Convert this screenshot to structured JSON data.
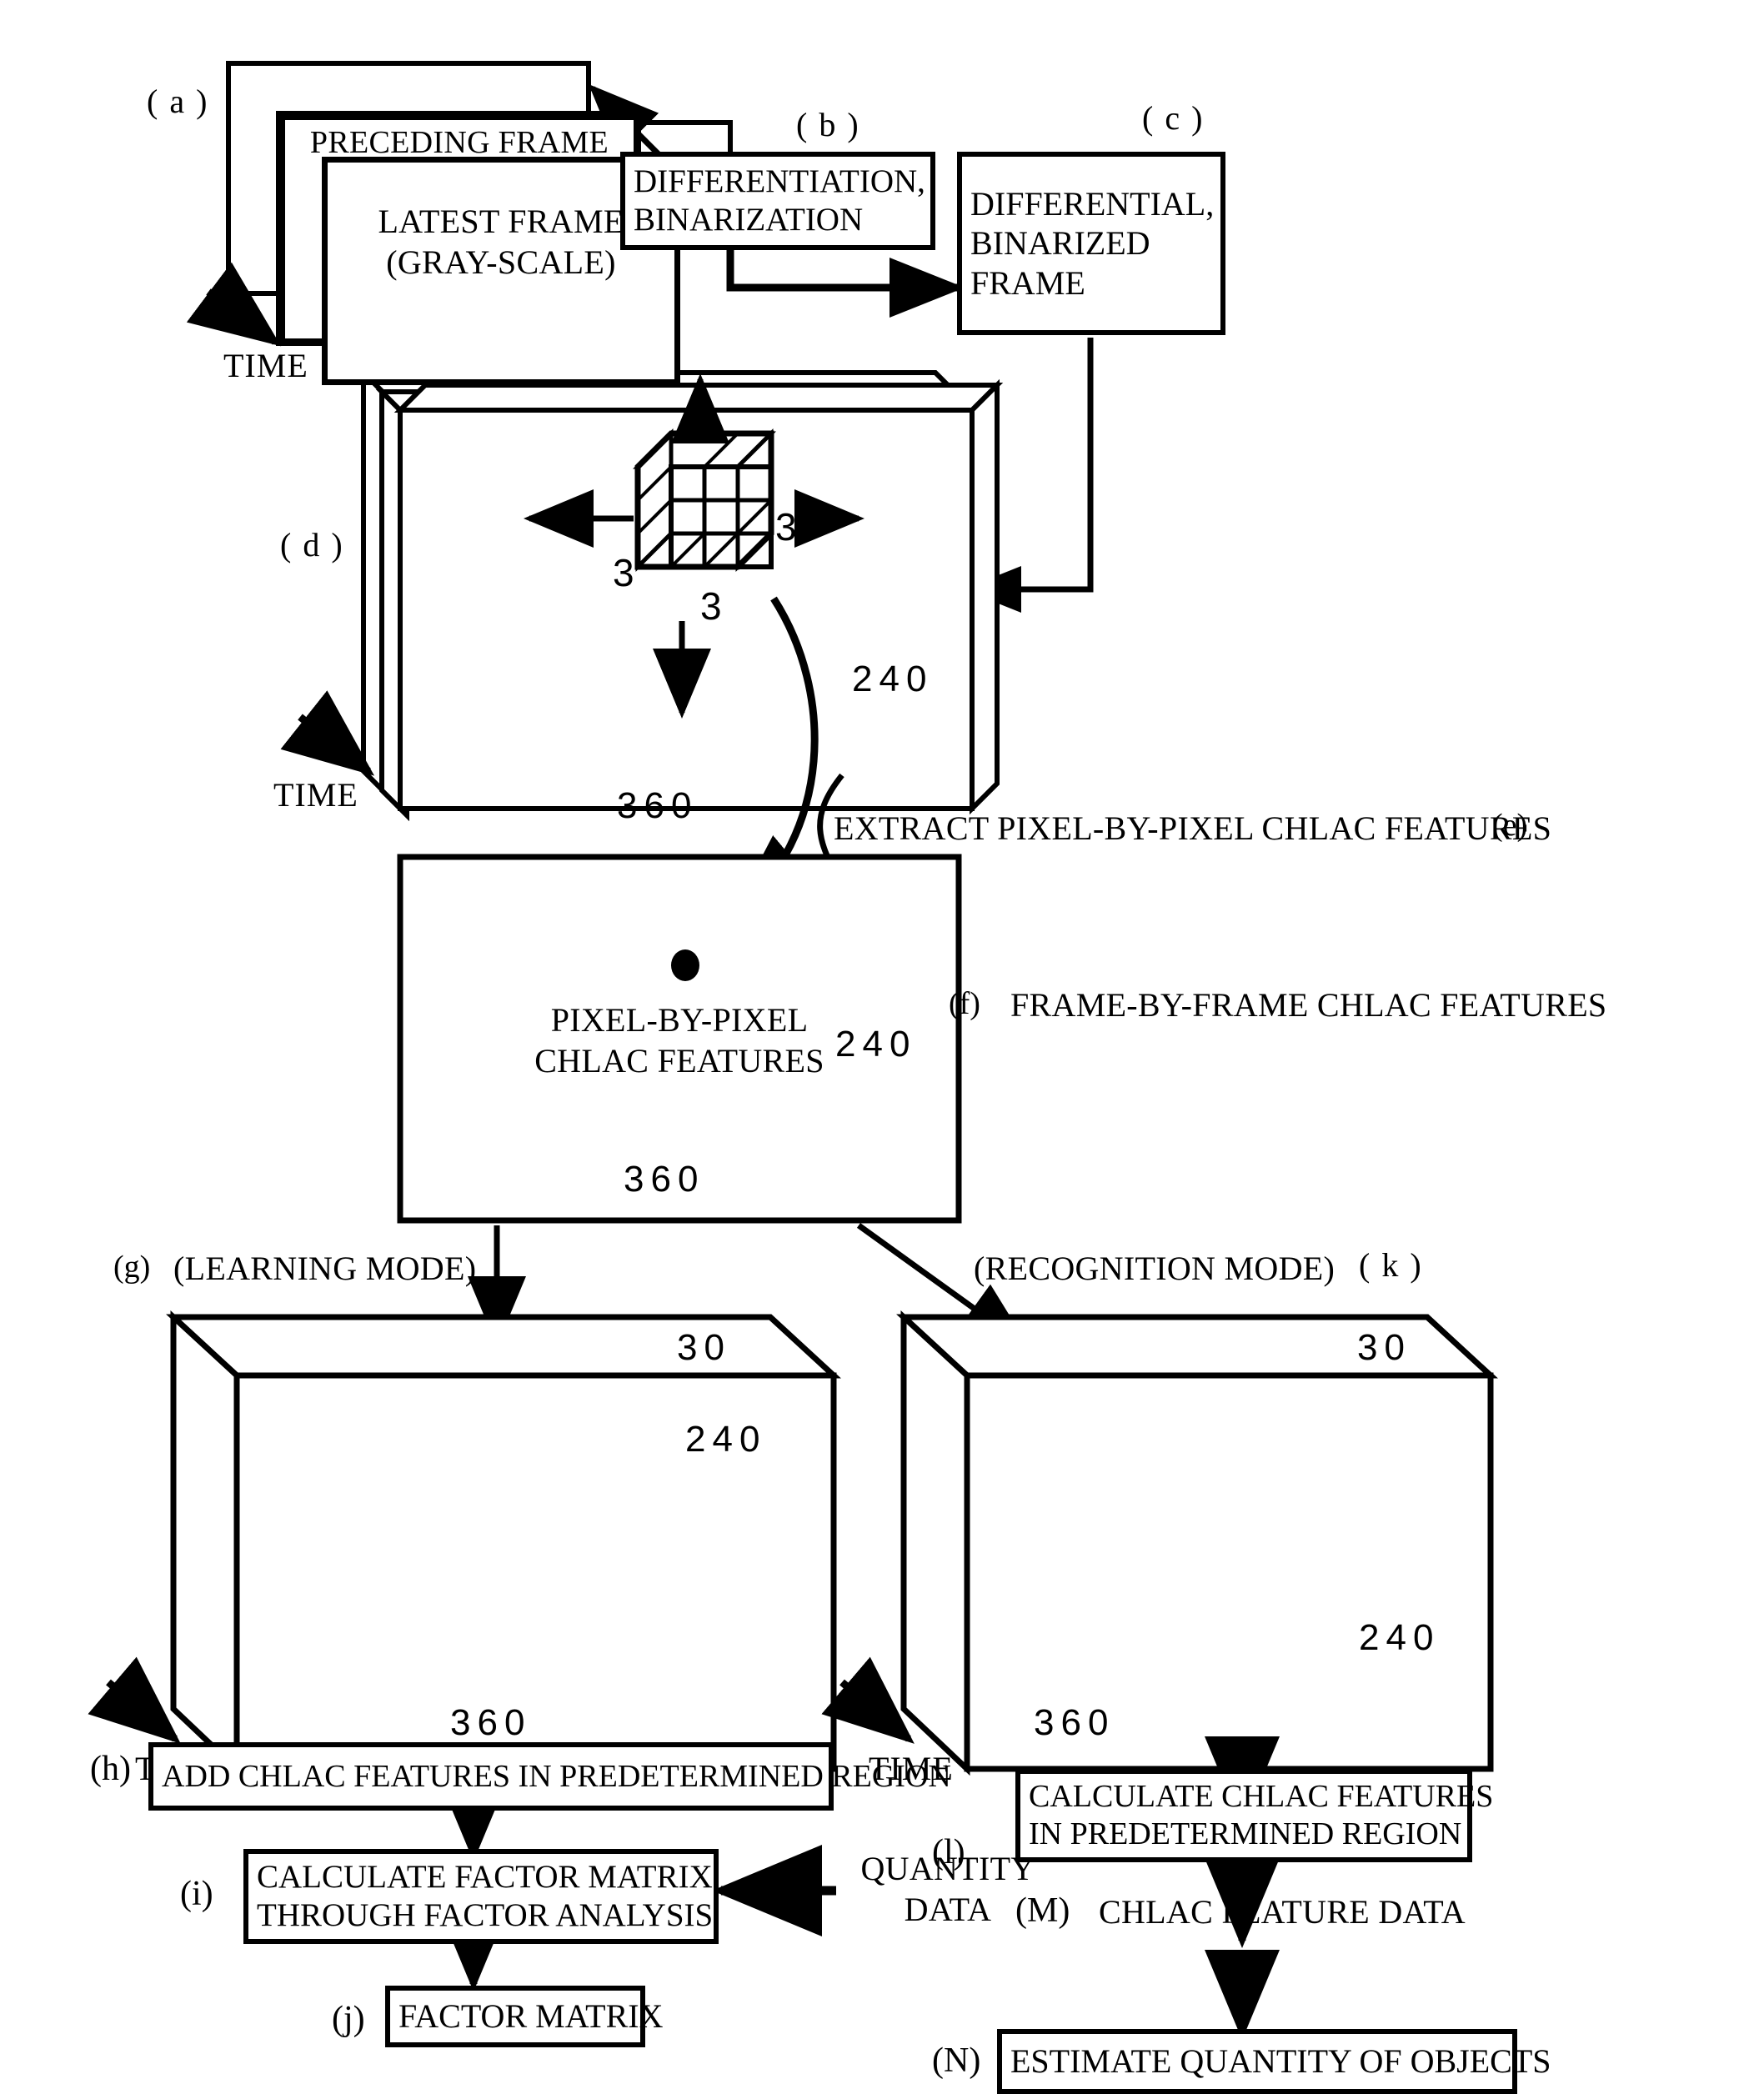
{
  "figure": {
    "type": "patent-flow-diagram",
    "title": ""
  },
  "steps": {
    "a": {
      "tag": "( a )",
      "frames": [
        {
          "label": ""
        },
        {
          "label": "PRECEDING FRAME"
        },
        {
          "label": "LATEST FRAME\n(GRAY-SCALE)"
        }
      ],
      "time_label": "TIME"
    },
    "b": {
      "tag": "( b )",
      "label": "DIFFERENTIATION,\nBINARIZATION"
    },
    "c": {
      "tag": "( c )",
      "label": "DIFFERENTIAL,\nBINARIZED\nFRAME"
    },
    "d": {
      "tag": "( d )",
      "width": "360",
      "height": "240",
      "time_label": "TIME",
      "kernel": {
        "x": "3",
        "y": "3",
        "z": "3",
        "cells": 3
      }
    },
    "e": {
      "tag": "(e)",
      "label": "EXTRACT PIXEL-BY-PIXEL CHLAC FEATURES"
    },
    "f": {
      "tag": "(f)",
      "label": "FRAME-BY-FRAME CHLAC FEATURES",
      "inner_label": "PIXEL-BY-PIXEL\nCHLAC FEATURES",
      "width": "360",
      "height": "240"
    },
    "g": {
      "tag": "(g)",
      "label": "(LEARNING MODE)",
      "depth": "30",
      "height": "240",
      "width": "360",
      "time_label": "TIME"
    },
    "h": {
      "tag": "(h)",
      "label": "ADD CHLAC FEATURES IN PREDETERMINED REGION"
    },
    "i": {
      "tag": "(i)",
      "label": "CALCULATE FACTOR MATRIX\nTHROUGH FACTOR ANALYSIS",
      "input_label": "QUANTITY\nDATA"
    },
    "j": {
      "tag": "(j)",
      "label": "FACTOR MATRIX"
    },
    "k": {
      "tag": "( k )",
      "label": "(RECOGNITION MODE)",
      "depth": "30",
      "height": "240",
      "width": "360",
      "time_label": "TIME"
    },
    "l": {
      "tag": "(l)",
      "label": "CALCULATE CHLAC FEATURES\nIN PREDETERMINED REGION"
    },
    "m": {
      "tag": "(M)",
      "label": "CHLAC FEATURE DATA"
    },
    "n": {
      "tag": "(N)",
      "label": "ESTIMATE QUANTITY OF OBJECTS"
    }
  },
  "colors": {
    "ink": "#000000",
    "paper": "#ffffff"
  }
}
